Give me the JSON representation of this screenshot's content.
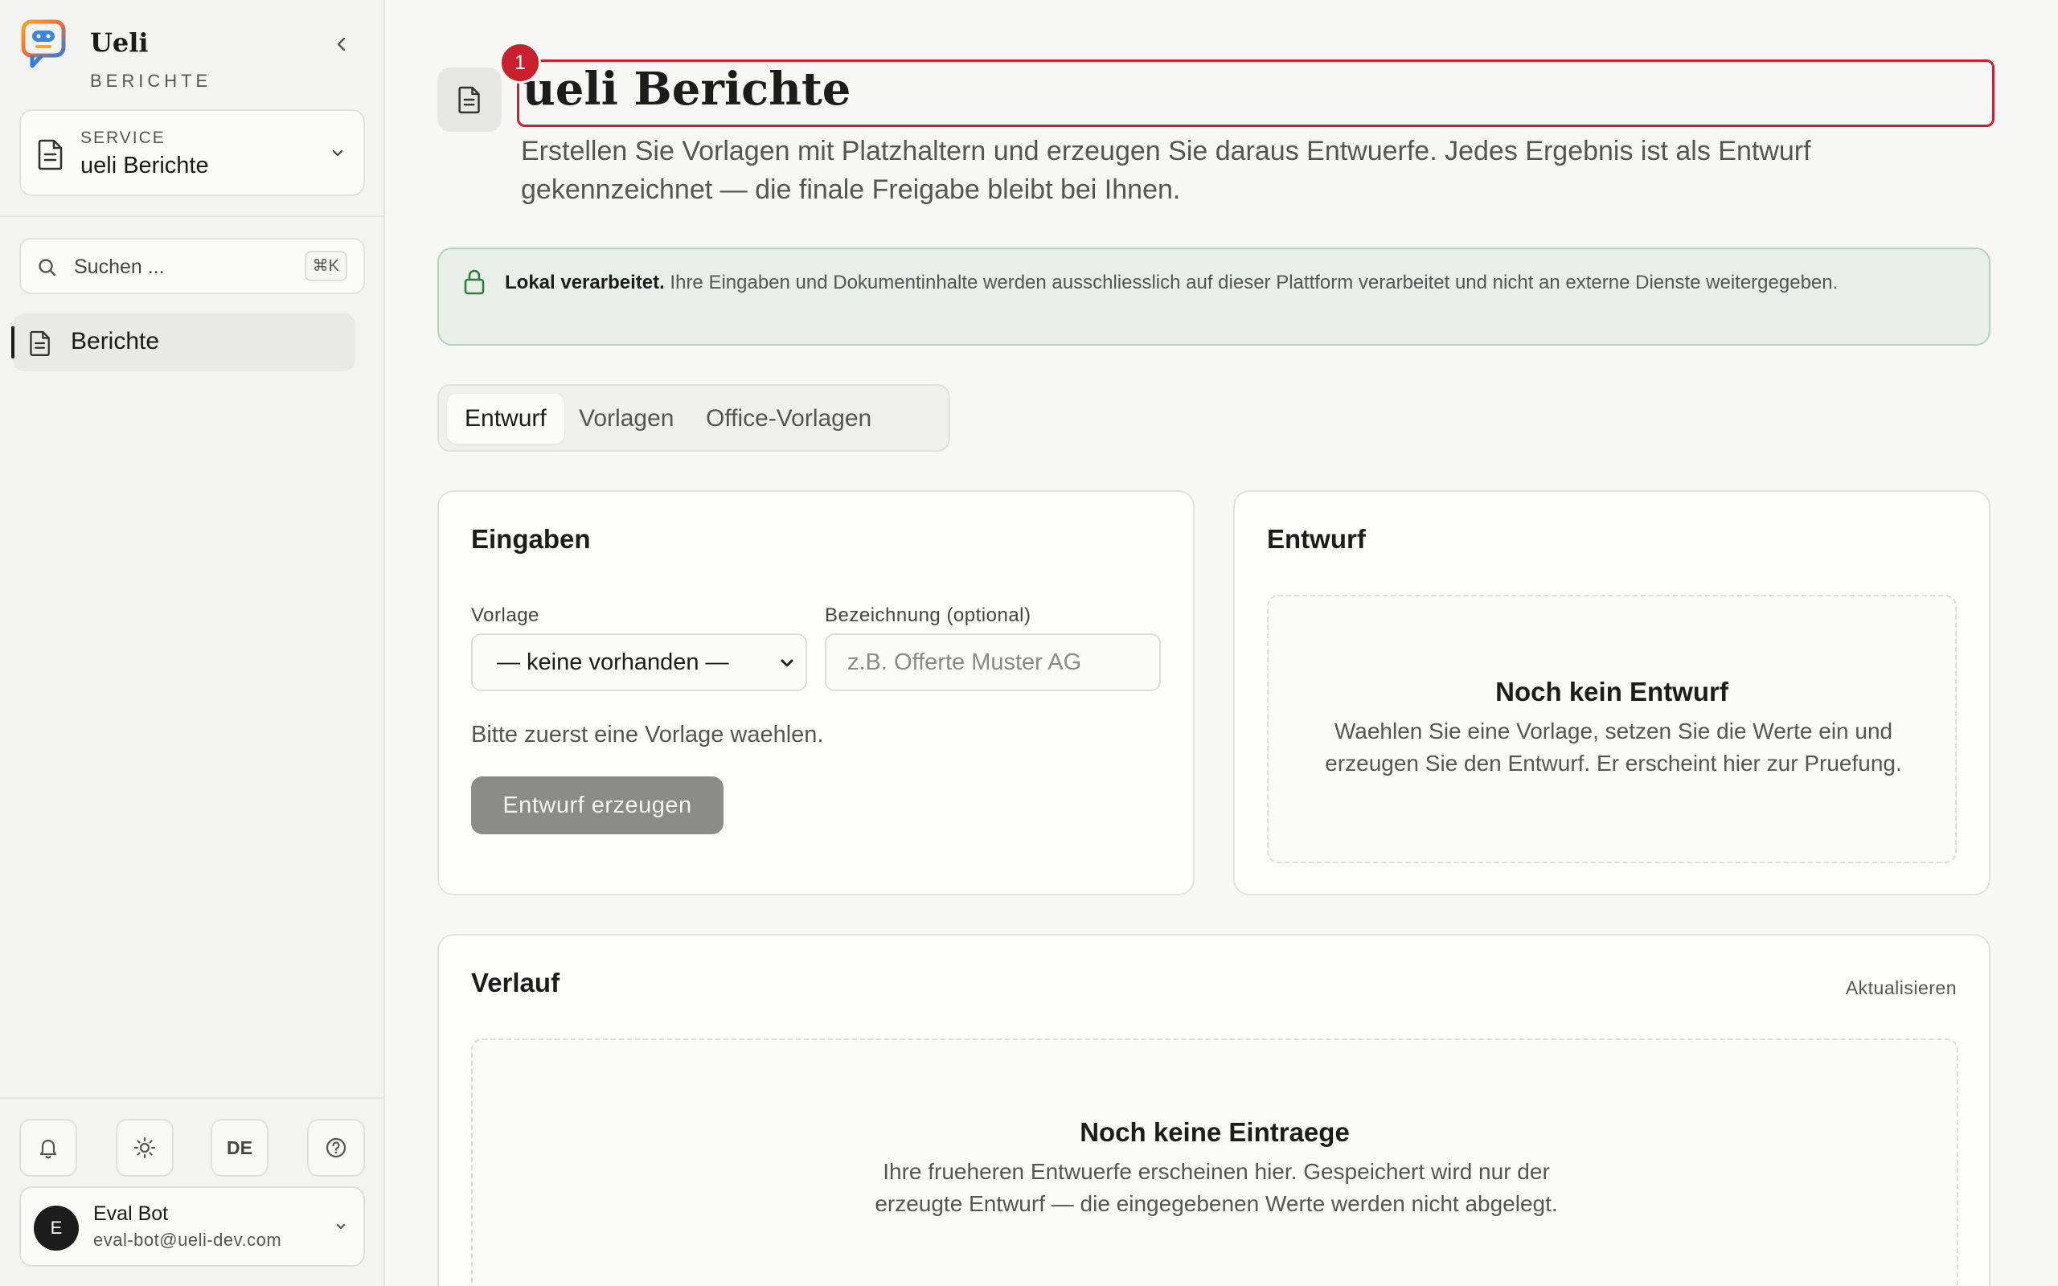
{
  "brand": {
    "name": "Ueli",
    "subtitle": "BERICHTE"
  },
  "service": {
    "label": "SERVICE",
    "value": "ueli Berichte"
  },
  "search": {
    "placeholder": "Suchen ...",
    "shortcut": "⌘K"
  },
  "sidebar": {
    "items": [
      {
        "label": "Berichte",
        "icon": "document-icon",
        "active": true
      }
    ]
  },
  "utilities": {
    "language": "DE"
  },
  "user": {
    "initial": "E",
    "name": "Eval Bot",
    "email": "eval-bot@ueli-dev.com"
  },
  "page": {
    "title": "ueli Berichte",
    "badge": "1",
    "subtitle": "Erstellen Sie Vorlagen mit Platzhaltern und erzeugen Sie daraus Entwuerfe. Jedes Ergebnis ist als Entwurf gekennzeichnet — die finale Freigabe bleibt bei Ihnen."
  },
  "banner": {
    "strong": "Lokal verarbeitet.",
    "text": "Ihre Eingaben und Dokumentinhalte werden ausschliesslich auf dieser Plattform verarbeitet und nicht an externe Dienste weitergegeben."
  },
  "tabs": [
    {
      "label": "Entwurf"
    },
    {
      "label": "Vorlagen"
    },
    {
      "label": "Office-Vorlagen"
    }
  ],
  "inputs_card": {
    "title": "Eingaben",
    "template_label": "Vorlage",
    "template_value": "— keine vorhanden —",
    "name_label": "Bezeichnung (optional)",
    "name_placeholder": "z.B. Offerte Muster AG",
    "name_value": "",
    "hint": "Bitte zuerst eine Vorlage waehlen.",
    "button": "Entwurf erzeugen"
  },
  "draft_card": {
    "title": "Entwurf",
    "empty_title": "Noch kein Entwurf",
    "empty_desc": "Waehlen Sie eine Vorlage, setzen Sie die Werte ein und erzeugen Sie den Entwurf. Er erscheint hier zur Pruefung."
  },
  "history_card": {
    "title": "Verlauf",
    "refresh": "Aktualisieren",
    "empty_title": "Noch keine Eintraege",
    "empty_desc": "Ihre frueheren Entwuerfe erscheinen hier. Gespeichert wird nur der erzeugte Entwurf — die eingegebenen Werte werden nicht abgelegt."
  },
  "colors": {
    "accent_red": "#c8202f",
    "banner_green": "#2f7d3c",
    "disabled_button": "#8b8b8a"
  }
}
